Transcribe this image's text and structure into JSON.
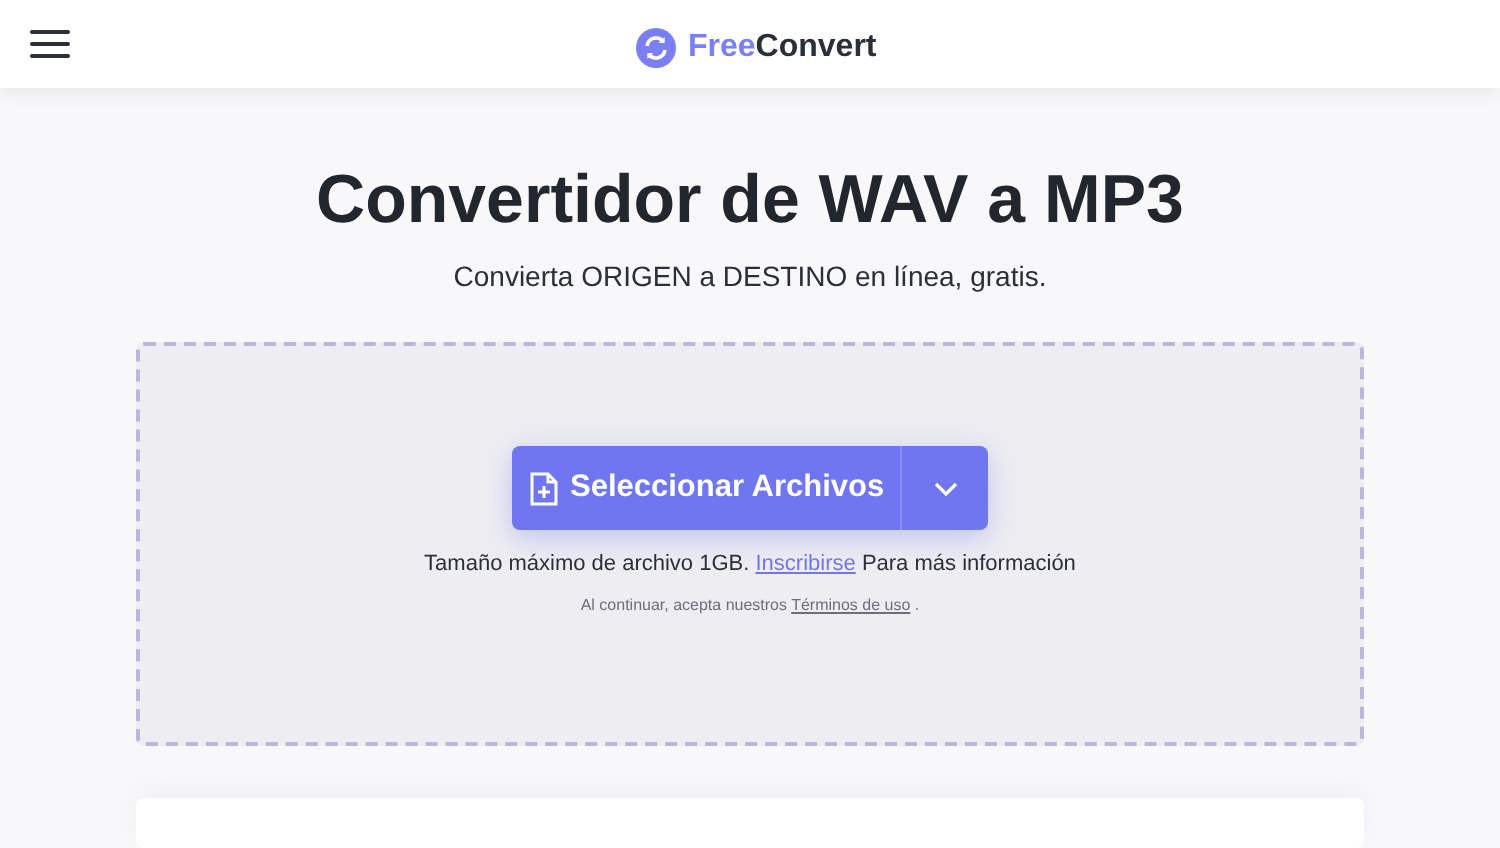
{
  "header": {
    "logo_accent": "Free",
    "logo_rest": "Convert"
  },
  "title": "Convertidor de WAV a MP3",
  "subtitle": "Convierta ORIGEN a DESTINO en línea, gratis.",
  "upload": {
    "button": "Seleccionar Archivos",
    "info_before": "Tamaño máximo de archivo 1GB.",
    "info_link": "Inscribirse",
    "info_after": "Para más información",
    "terms_before": "Al continuar, acepta nuestros",
    "terms_link": "Términos de uso",
    "terms_after": "."
  }
}
